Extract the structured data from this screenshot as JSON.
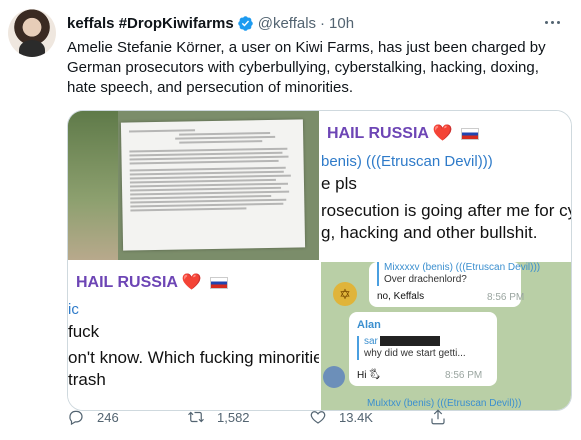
{
  "author": {
    "name": "keffals #DropKiwifarms",
    "handle": "@keffals",
    "separator": "·",
    "time": "10h"
  },
  "tweet_text": "Amelie Stefanie Körner, a user on Kiwi Farms, has just been charged by German prosecutors with cyberbullying, cyberstalking, hacking, doxing, hate speech, and persecution of minorities.",
  "media": {
    "image2": {
      "hail": "HAIL RUSSIA",
      "heart": "❤️",
      "name_line": "benis) (((Etruscan Devil)))",
      "line1": "e pls",
      "line2": "rosecution is going after me for cyberb",
      "line3": "g, hacking and other bullshit."
    },
    "image3": {
      "hail": "HAIL RUSSIA",
      "heart": "❤️",
      "name_line": "ic",
      "line1": "fuck",
      "line2": "on't know. Which fucking minorities did I",
      "line3": "trash"
    },
    "image4": {
      "quote_name": "Mixxxxv (benis) (((Etruscan Devil)))",
      "quote_text": "Over drachenlord?",
      "msg1_text": "no, Keffals",
      "msg1_time": "8:56 PM",
      "sender2": "Alan",
      "quote2_name": "sar",
      "quote2_text": "why did we start getti...",
      "msg2_text": "Hi 🖏",
      "msg2_time": "8:56 PM",
      "bottom_name": "Mulxtxv (benis) (((Etruscan Devil)))"
    }
  },
  "actions": {
    "replies": "246",
    "retweets": "1,582",
    "likes": "13.4K"
  },
  "colors": {
    "verified": "#1d9bf0",
    "muted_text": "#536471",
    "telegram_purple": "#6d45b5",
    "telegram_link": "#2f7bc9"
  }
}
